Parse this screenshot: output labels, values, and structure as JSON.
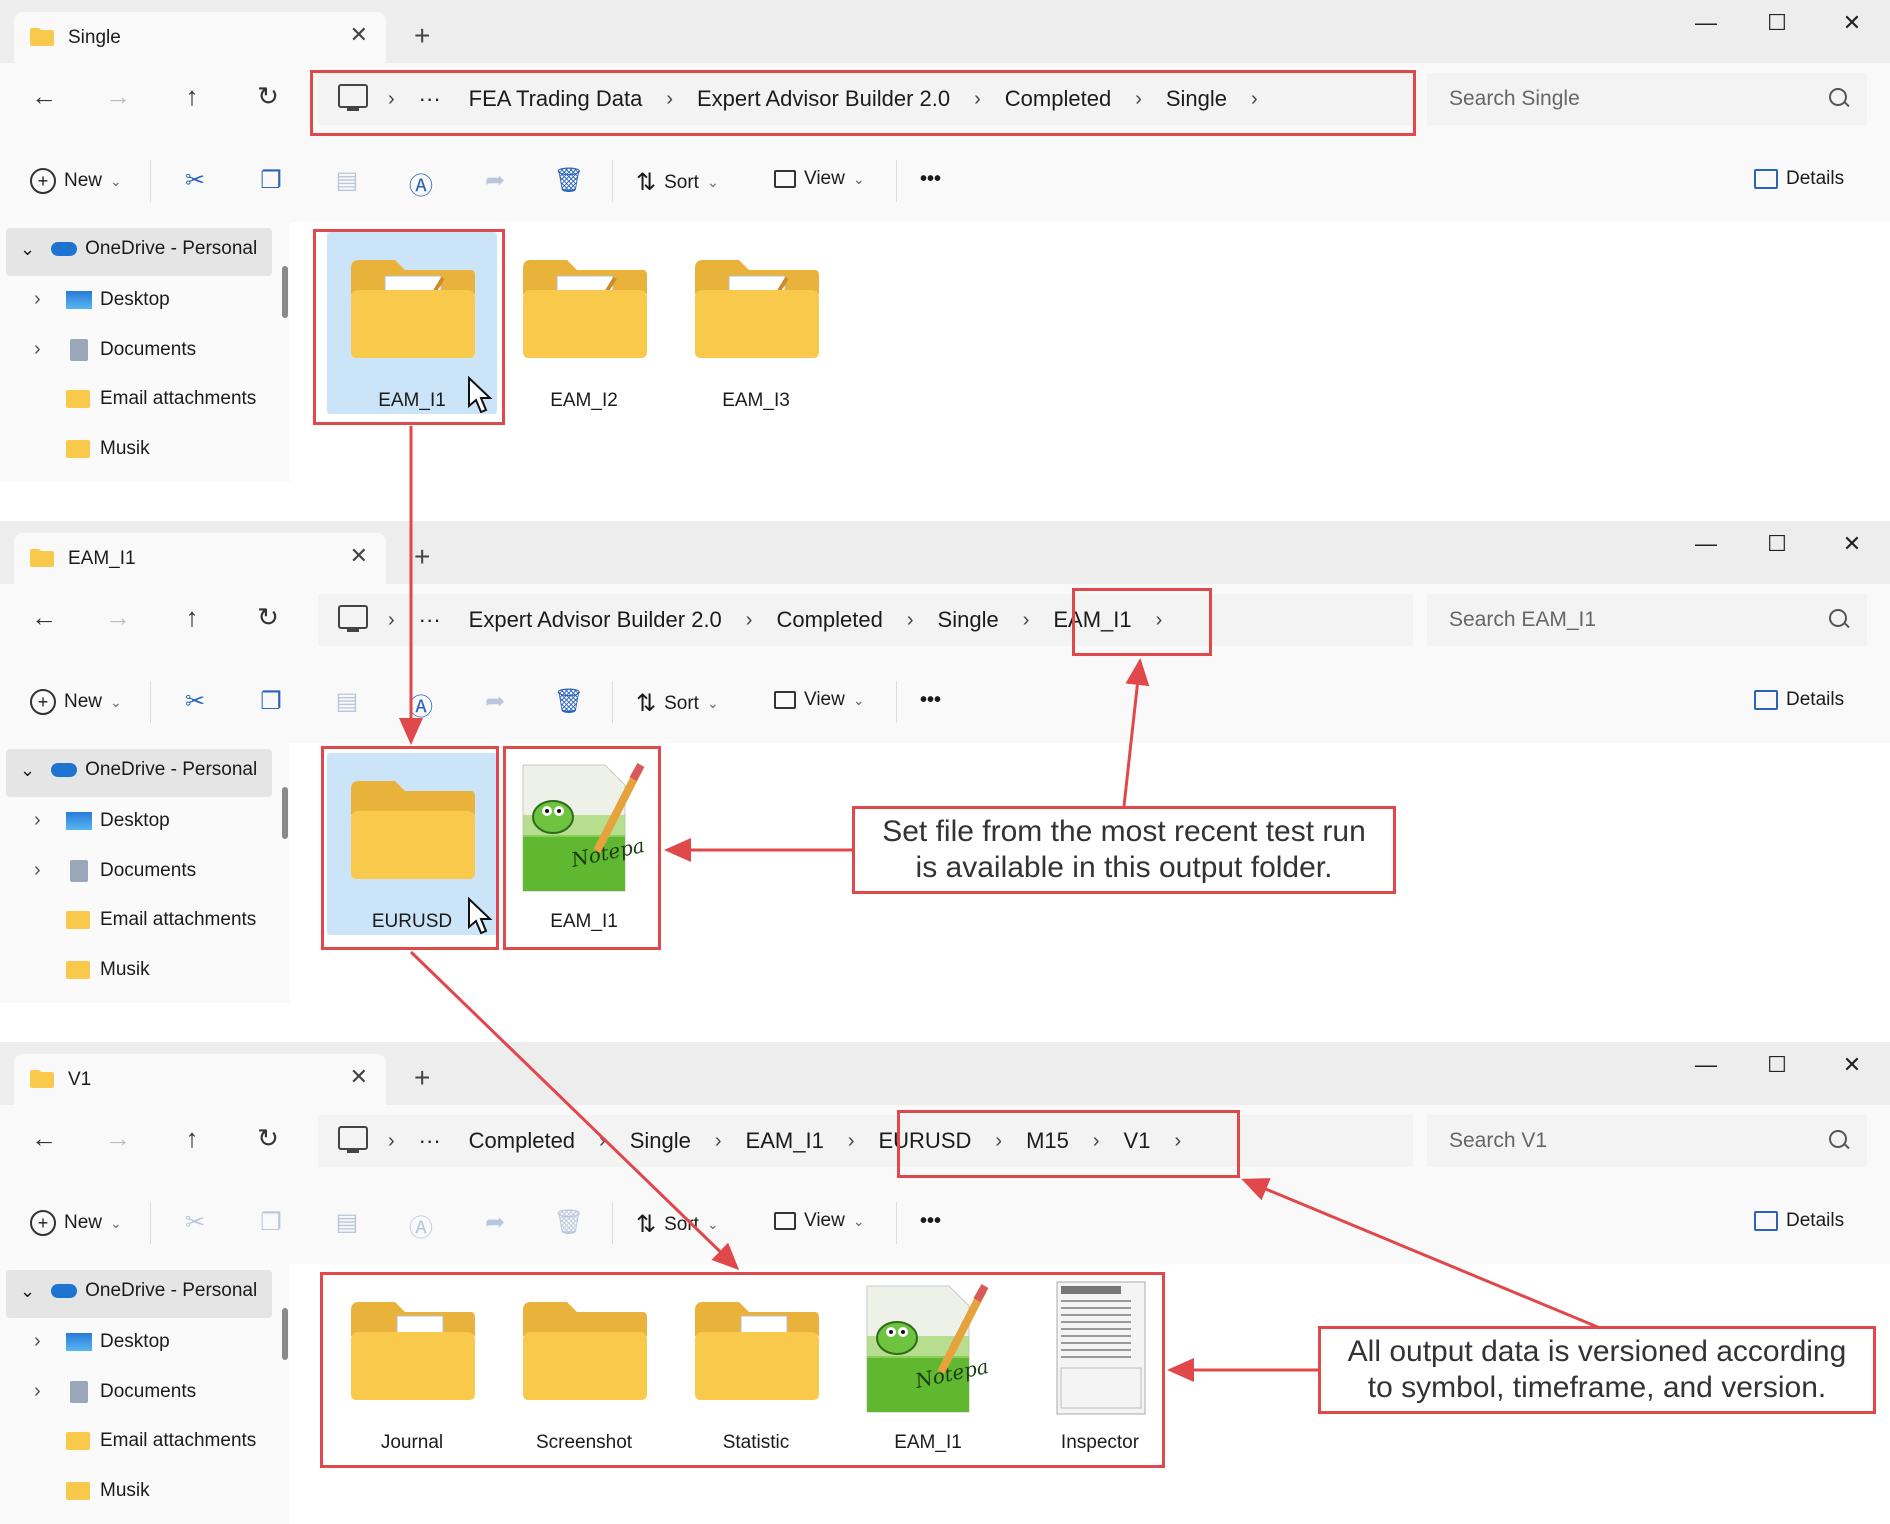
{
  "colors": {
    "accent_red": "#e0484b",
    "folder_yellow": "#f8c94a",
    "selection": "#cce4f7",
    "icon_blue": "#2a63b8"
  },
  "windows": [
    {
      "tab_title": "Single",
      "breadcrumbs": [
        "FEA Trading Data",
        "Expert Advisor Builder 2.0",
        "Completed",
        "Single"
      ],
      "search_placeholder": "Search Single",
      "items": [
        {
          "label": "EAM_I1",
          "type": "folder-notepad",
          "selected": true
        },
        {
          "label": "EAM_I2",
          "type": "folder-notepad",
          "selected": false
        },
        {
          "label": "EAM_I3",
          "type": "folder-notepad",
          "selected": false
        }
      ]
    },
    {
      "tab_title": "EAM_I1",
      "breadcrumbs": [
        "Expert Advisor Builder 2.0",
        "Completed",
        "Single",
        "EAM_I1"
      ],
      "search_placeholder": "Search EAM_I1",
      "items": [
        {
          "label": "EURUSD",
          "type": "folder",
          "selected": true
        },
        {
          "label": "EAM_I1",
          "type": "notepad-file",
          "selected": false
        }
      ]
    },
    {
      "tab_title": "V1",
      "breadcrumbs": [
        "Completed",
        "Single",
        "EAM_I1",
        "EURUSD",
        "M15",
        "V1"
      ],
      "search_placeholder": "Search V1",
      "items": [
        {
          "label": "Journal",
          "type": "folder-excel",
          "selected": false
        },
        {
          "label": "Screenshot",
          "type": "folder",
          "selected": false
        },
        {
          "label": "Statistic",
          "type": "folder-excel",
          "selected": false
        },
        {
          "label": "EAM_I1",
          "type": "notepad-file",
          "selected": false
        },
        {
          "label": "Inspector",
          "type": "document",
          "selected": false
        }
      ]
    }
  ],
  "toolbar": {
    "new_label": "New",
    "sort_label": "Sort",
    "view_label": "View",
    "details_label": "Details",
    "more_label": "•••"
  },
  "navpane": {
    "onedrive_label": "OneDrive - Personal",
    "items": [
      "Desktop",
      "Documents",
      "Email attachments",
      "Musik"
    ]
  },
  "glyphs": {
    "back": "←",
    "forward": "→",
    "up": "↑",
    "refresh": "↻",
    "chevron": "›",
    "overflow": "···",
    "close": "✕",
    "plus": "+",
    "minimize": "—",
    "maximize": "☐",
    "expand_down": "⌄",
    "expand_right": "›",
    "sort_arrows": "⇅",
    "dropdown": "⌄"
  },
  "callouts": {
    "set_file": [
      "Set file from the most recent test run",
      "is available in this output folder."
    ],
    "versioned": [
      "All output data is versioned according",
      "to symbol, timeframe, and version."
    ]
  }
}
